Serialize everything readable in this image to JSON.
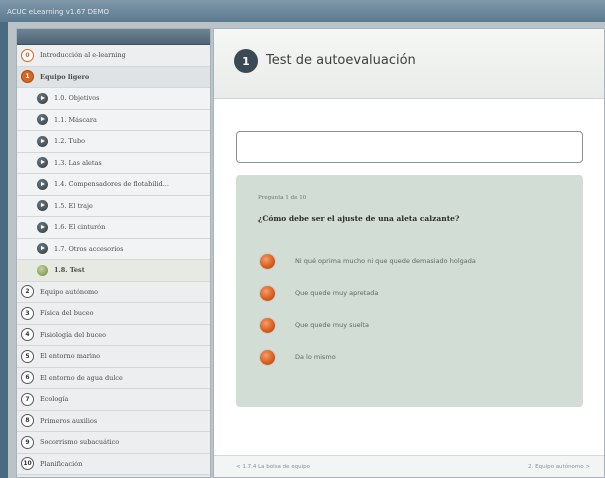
{
  "window": {
    "title": "ACUC eLearning v1.67 DEMO"
  },
  "sidebar": {
    "items": [
      {
        "marker": "0",
        "label": "Introducción al e-learning",
        "kind": "top"
      },
      {
        "marker": "1",
        "label": "Equipo ligero",
        "kind": "top-active"
      },
      {
        "marker": "",
        "label": "1.0. Objetivos",
        "kind": "sub"
      },
      {
        "marker": "",
        "label": "1.1. Máscara",
        "kind": "sub"
      },
      {
        "marker": "",
        "label": "1.2. Tubo",
        "kind": "sub"
      },
      {
        "marker": "",
        "label": "1.3. Las aletas",
        "kind": "sub"
      },
      {
        "marker": "",
        "label": "1.4. Compensadores de flotabilid...",
        "kind": "sub"
      },
      {
        "marker": "",
        "label": "1.5. El traje",
        "kind": "sub"
      },
      {
        "marker": "",
        "label": "1.6. El cinturón",
        "kind": "sub"
      },
      {
        "marker": "",
        "label": "1.7. Otros accesorios",
        "kind": "sub"
      },
      {
        "marker": "",
        "label": "1.8. Test",
        "kind": "sub-current"
      },
      {
        "marker": "2",
        "label": "Equipo autónomo",
        "kind": "top"
      },
      {
        "marker": "3",
        "label": "Física del buceo",
        "kind": "top"
      },
      {
        "marker": "4",
        "label": "Fisiología del buceo",
        "kind": "top"
      },
      {
        "marker": "5",
        "label": "El entorno marino",
        "kind": "top"
      },
      {
        "marker": "6",
        "label": "El entorno de agua dulce",
        "kind": "top"
      },
      {
        "marker": "7",
        "label": "Ecología",
        "kind": "top"
      },
      {
        "marker": "8",
        "label": "Primeros auxilios",
        "kind": "top"
      },
      {
        "marker": "9",
        "label": "Socorrismo subacuático",
        "kind": "top"
      },
      {
        "marker": "10",
        "label": "Planificación",
        "kind": "top"
      }
    ]
  },
  "main": {
    "section_number": "1",
    "title": "Test de autoevaluación",
    "answer_value": "",
    "question": {
      "counter": "Pregunta 1 de 10",
      "text": "¿Cómo debe ser el ajuste de una aleta calzante?",
      "options": [
        "Ni qué oprima mucho ni que quede demasiado holgada",
        "Que quede muy apretada",
        "Que quede muy suelta",
        "Da lo mismo"
      ]
    },
    "footer": {
      "prev": "< 1.7.4 La bolsa de equipo",
      "next": "2. Equipo autónomo >"
    }
  },
  "colors": {
    "accent_orange": "#d76623",
    "question_bg": "#d1ddd5",
    "sidebar_head": "#5a7082"
  }
}
